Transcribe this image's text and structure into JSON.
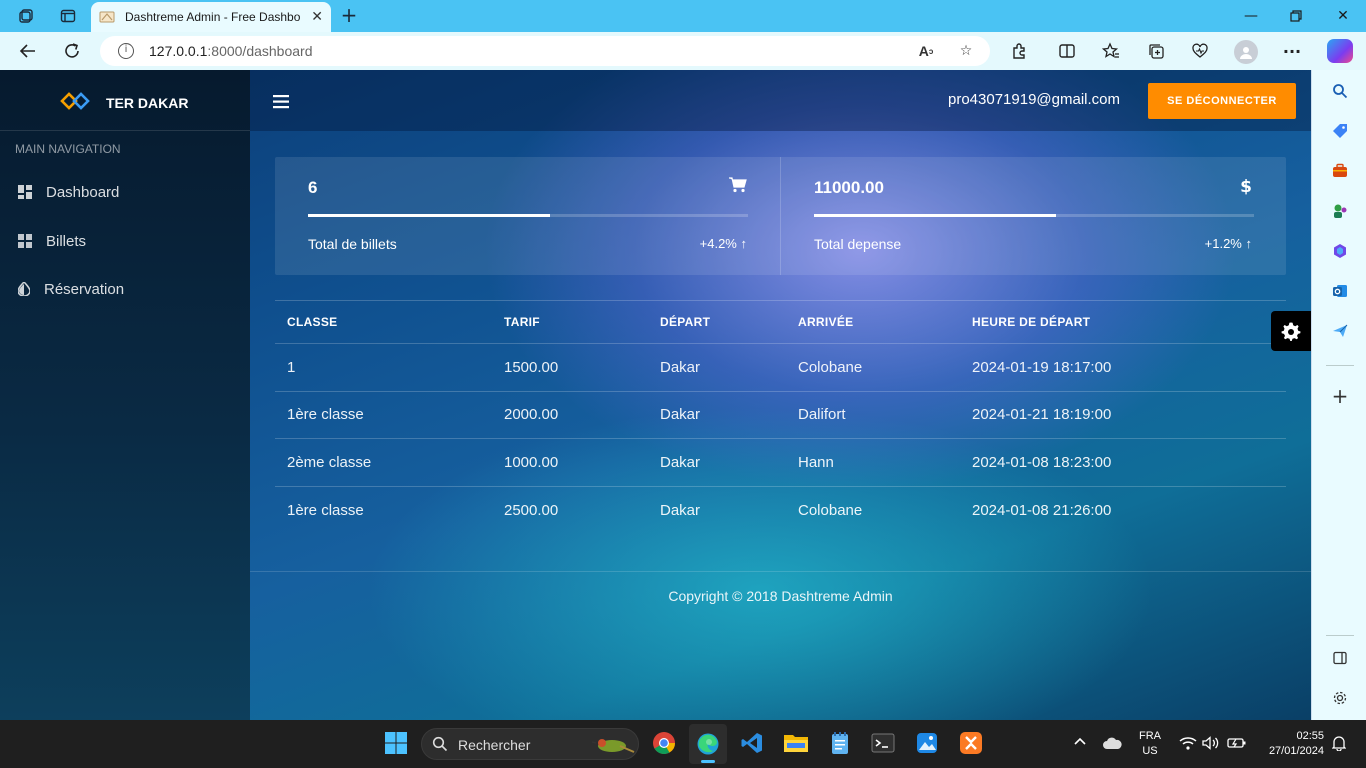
{
  "browser": {
    "tab_title": "Dashtreme Admin - Free Dashbo",
    "url_host": "127.0.0.1",
    "url_rest": ":8000/dashboard"
  },
  "app": {
    "brand": "TER DAKAR",
    "nav_header": "MAIN NAVIGATION",
    "nav": [
      {
        "label": "Dashboard",
        "icon": "dashboard-grid-icon"
      },
      {
        "label": "Billets",
        "icon": "grid-icon"
      },
      {
        "label": "Réservation",
        "icon": "tint-icon"
      }
    ],
    "user_email": "pro43071919@gmail.com",
    "logout_label": "SE DÉCONNECTER",
    "accent": "#ff8c00"
  },
  "stats": [
    {
      "value": "6",
      "icon": "cart-icon",
      "label": "Total de billets",
      "change": "+4.2%",
      "progress": 0.55
    },
    {
      "value": "11000.00",
      "icon": "dollar-icon",
      "label": "Total depense",
      "change": "+1.2%",
      "progress": 0.55
    }
  ],
  "table": {
    "headers": [
      "CLASSE",
      "TARIF",
      "DÉPART",
      "ARRIVÉE",
      "HEURE DE DÉPART"
    ],
    "rows": [
      [
        "1",
        "1500.00",
        "Dakar",
        "Colobane",
        "2024-01-19 18:17:00"
      ],
      [
        "1ère classe",
        "2000.00",
        "Dakar",
        "Dalifort",
        "2024-01-21 18:19:00"
      ],
      [
        "2ème classe",
        "1000.00",
        "Dakar",
        "Hann",
        "2024-01-08 18:23:00"
      ],
      [
        "1ère classe",
        "2500.00",
        "Dakar",
        "Colobane",
        "2024-01-08 21:26:00"
      ]
    ]
  },
  "footer": "Copyright © 2018 Dashtreme Admin",
  "taskbar": {
    "search_placeholder": "Rechercher",
    "lang": "FRA",
    "region": "US",
    "time": "02:55",
    "date": "27/01/2024"
  }
}
